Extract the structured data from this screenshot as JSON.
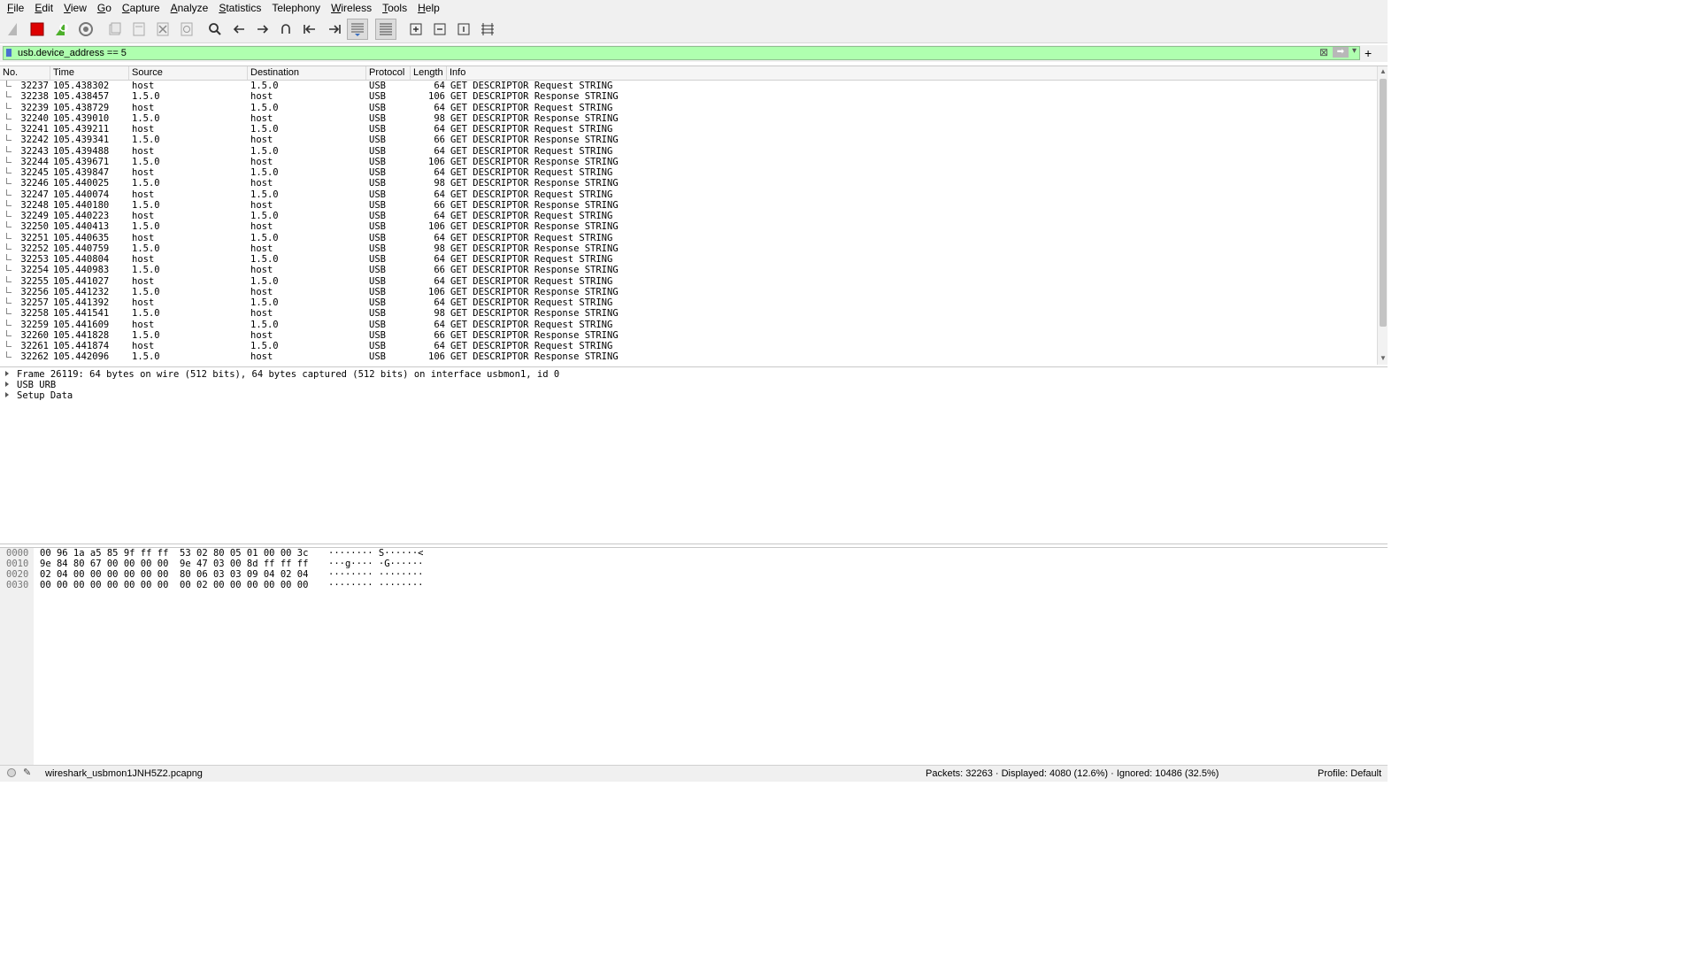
{
  "menubar": {
    "items": [
      {
        "ul": "F",
        "rest": "ile"
      },
      {
        "ul": "E",
        "rest": "dit"
      },
      {
        "ul": "V",
        "rest": "iew"
      },
      {
        "ul": "G",
        "rest": "o"
      },
      {
        "ul": "C",
        "rest": "apture"
      },
      {
        "ul": "A",
        "rest": "nalyze"
      },
      {
        "ul": "S",
        "rest": "tatistics"
      },
      {
        "ul": "",
        "rest": "Telephony"
      },
      {
        "ul": "W",
        "rest": "ireless"
      },
      {
        "ul": "T",
        "rest": "ools"
      },
      {
        "ul": "H",
        "rest": "elp"
      }
    ]
  },
  "toolbar": {
    "icons": [
      "shark-fin-icon",
      "stop-icon",
      "restart-icon",
      "options-gear-icon",
      "open-file-icon",
      "save-file-icon",
      "close-file-icon",
      "reload-icon",
      "find-icon",
      "back-arrow-icon",
      "forward-arrow-icon",
      "goto-packet-icon",
      "first-packet-icon",
      "last-packet-icon",
      "autoscroll-icon",
      "colorize-icon",
      "zoom-in-icon",
      "zoom-out-icon",
      "normal-size-icon",
      "resize-columns-icon"
    ]
  },
  "filter": {
    "value": "usb.device_address == 5",
    "clear_symbol": "⊠",
    "apply_symbol": "➡",
    "dropdown_symbol": "▾",
    "add_symbol": "+"
  },
  "packet_list": {
    "columns": [
      "No.",
      "Time",
      "Source",
      "Destination",
      "Protocol",
      "Length",
      "Info"
    ],
    "rows": [
      {
        "no": "32237",
        "time": "105.438302",
        "src": "host",
        "dst": "1.5.0",
        "proto": "USB",
        "len": "64",
        "info": "GET DESCRIPTOR Request STRING"
      },
      {
        "no": "32238",
        "time": "105.438457",
        "src": "1.5.0",
        "dst": "host",
        "proto": "USB",
        "len": "106",
        "info": "GET DESCRIPTOR Response STRING"
      },
      {
        "no": "32239",
        "time": "105.438729",
        "src": "host",
        "dst": "1.5.0",
        "proto": "USB",
        "len": "64",
        "info": "GET DESCRIPTOR Request STRING"
      },
      {
        "no": "32240",
        "time": "105.439010",
        "src": "1.5.0",
        "dst": "host",
        "proto": "USB",
        "len": "98",
        "info": "GET DESCRIPTOR Response STRING"
      },
      {
        "no": "32241",
        "time": "105.439211",
        "src": "host",
        "dst": "1.5.0",
        "proto": "USB",
        "len": "64",
        "info": "GET DESCRIPTOR Request STRING"
      },
      {
        "no": "32242",
        "time": "105.439341",
        "src": "1.5.0",
        "dst": "host",
        "proto": "USB",
        "len": "66",
        "info": "GET DESCRIPTOR Response STRING"
      },
      {
        "no": "32243",
        "time": "105.439488",
        "src": "host",
        "dst": "1.5.0",
        "proto": "USB",
        "len": "64",
        "info": "GET DESCRIPTOR Request STRING"
      },
      {
        "no": "32244",
        "time": "105.439671",
        "src": "1.5.0",
        "dst": "host",
        "proto": "USB",
        "len": "106",
        "info": "GET DESCRIPTOR Response STRING"
      },
      {
        "no": "32245",
        "time": "105.439847",
        "src": "host",
        "dst": "1.5.0",
        "proto": "USB",
        "len": "64",
        "info": "GET DESCRIPTOR Request STRING"
      },
      {
        "no": "32246",
        "time": "105.440025",
        "src": "1.5.0",
        "dst": "host",
        "proto": "USB",
        "len": "98",
        "info": "GET DESCRIPTOR Response STRING"
      },
      {
        "no": "32247",
        "time": "105.440074",
        "src": "host",
        "dst": "1.5.0",
        "proto": "USB",
        "len": "64",
        "info": "GET DESCRIPTOR Request STRING"
      },
      {
        "no": "32248",
        "time": "105.440180",
        "src": "1.5.0",
        "dst": "host",
        "proto": "USB",
        "len": "66",
        "info": "GET DESCRIPTOR Response STRING"
      },
      {
        "no": "32249",
        "time": "105.440223",
        "src": "host",
        "dst": "1.5.0",
        "proto": "USB",
        "len": "64",
        "info": "GET DESCRIPTOR Request STRING"
      },
      {
        "no": "32250",
        "time": "105.440413",
        "src": "1.5.0",
        "dst": "host",
        "proto": "USB",
        "len": "106",
        "info": "GET DESCRIPTOR Response STRING"
      },
      {
        "no": "32251",
        "time": "105.440635",
        "src": "host",
        "dst": "1.5.0",
        "proto": "USB",
        "len": "64",
        "info": "GET DESCRIPTOR Request STRING"
      },
      {
        "no": "32252",
        "time": "105.440759",
        "src": "1.5.0",
        "dst": "host",
        "proto": "USB",
        "len": "98",
        "info": "GET DESCRIPTOR Response STRING"
      },
      {
        "no": "32253",
        "time": "105.440804",
        "src": "host",
        "dst": "1.5.0",
        "proto": "USB",
        "len": "64",
        "info": "GET DESCRIPTOR Request STRING"
      },
      {
        "no": "32254",
        "time": "105.440983",
        "src": "1.5.0",
        "dst": "host",
        "proto": "USB",
        "len": "66",
        "info": "GET DESCRIPTOR Response STRING"
      },
      {
        "no": "32255",
        "time": "105.441027",
        "src": "host",
        "dst": "1.5.0",
        "proto": "USB",
        "len": "64",
        "info": "GET DESCRIPTOR Request STRING"
      },
      {
        "no": "32256",
        "time": "105.441232",
        "src": "1.5.0",
        "dst": "host",
        "proto": "USB",
        "len": "106",
        "info": "GET DESCRIPTOR Response STRING"
      },
      {
        "no": "32257",
        "time": "105.441392",
        "src": "host",
        "dst": "1.5.0",
        "proto": "USB",
        "len": "64",
        "info": "GET DESCRIPTOR Request STRING"
      },
      {
        "no": "32258",
        "time": "105.441541",
        "src": "1.5.0",
        "dst": "host",
        "proto": "USB",
        "len": "98",
        "info": "GET DESCRIPTOR Response STRING"
      },
      {
        "no": "32259",
        "time": "105.441609",
        "src": "host",
        "dst": "1.5.0",
        "proto": "USB",
        "len": "64",
        "info": "GET DESCRIPTOR Request STRING"
      },
      {
        "no": "32260",
        "time": "105.441828",
        "src": "1.5.0",
        "dst": "host",
        "proto": "USB",
        "len": "66",
        "info": "GET DESCRIPTOR Response STRING"
      },
      {
        "no": "32261",
        "time": "105.441874",
        "src": "host",
        "dst": "1.5.0",
        "proto": "USB",
        "len": "64",
        "info": "GET DESCRIPTOR Request STRING"
      },
      {
        "no": "32262",
        "time": "105.442096",
        "src": "1.5.0",
        "dst": "host",
        "proto": "USB",
        "len": "106",
        "info": "GET DESCRIPTOR Response STRING"
      }
    ]
  },
  "details": {
    "items": [
      "Frame 26119: 64 bytes on wire (512 bits), 64 bytes captured (512 bits) on interface usbmon1, id 0",
      "USB URB",
      "Setup Data"
    ]
  },
  "bytes": {
    "rows": [
      {
        "offset": "0000",
        "hex": "00 96 1a a5 85 9f ff ff  53 02 80 05 01 00 00 3c",
        "ascii": "········ S······<"
      },
      {
        "offset": "0010",
        "hex": "9e 84 80 67 00 00 00 00  9e 47 03 00 8d ff ff ff",
        "ascii": "···g···· ·G······"
      },
      {
        "offset": "0020",
        "hex": "02 04 00 00 00 00 00 00  80 06 03 03 09 04 02 04",
        "ascii": "········ ········"
      },
      {
        "offset": "0030",
        "hex": "00 00 00 00 00 00 00 00  00 02 00 00 00 00 00 00",
        "ascii": "········ ········"
      }
    ]
  },
  "status": {
    "file": "wireshark_usbmon1JNH5Z2.pcapng",
    "packets": "Packets: 32263 · Displayed: 4080 (12.6%) · Ignored: 10486 (32.5%)",
    "profile": "Profile: Default"
  }
}
